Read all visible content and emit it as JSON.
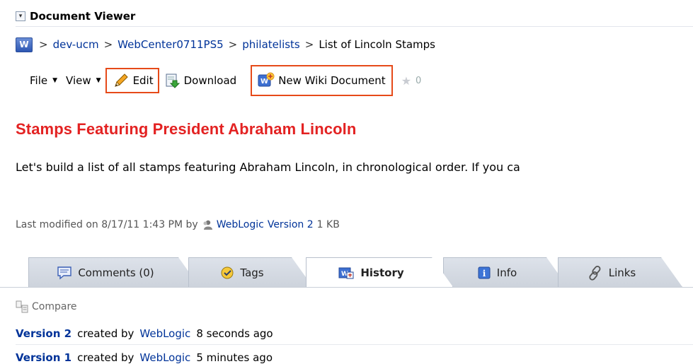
{
  "panel": {
    "title": "Document Viewer"
  },
  "breadcrumb": {
    "logo_letter": "W",
    "items": [
      "dev-ucm",
      "WebCenter0711PS5",
      "philatelists",
      "List of Lincoln Stamps"
    ]
  },
  "toolbar": {
    "file_label": "File",
    "view_label": "View",
    "edit_label": "Edit",
    "download_label": "Download",
    "new_wiki_label": "New Wiki Document",
    "star_count": "0"
  },
  "document": {
    "title": "Stamps Featuring President Abraham Lincoln",
    "body": "Let's build a list of all stamps featuring Abraham Lincoln, in chronological order.  If you ca"
  },
  "meta": {
    "prefix": "Last modified on 8/17/11 1:43 PM by",
    "author": "WebLogic",
    "version": "Version 2",
    "size": "1 KB"
  },
  "tabs": [
    {
      "label": "Comments (0)",
      "icon": "comment-icon"
    },
    {
      "label": "Tags",
      "icon": "tag-icon"
    },
    {
      "label": "History",
      "icon": "history-icon"
    },
    {
      "label": "Info",
      "icon": "info-icon"
    },
    {
      "label": "Links",
      "icon": "link-icon"
    }
  ],
  "history": {
    "compare_label": "Compare",
    "rows": [
      {
        "version": "Version 2",
        "created_by": "created by",
        "user": "WebLogic",
        "when": "8 seconds ago"
      },
      {
        "version": "Version 1",
        "created_by": "created by",
        "user": "WebLogic",
        "when": "5 minutes ago"
      }
    ]
  },
  "colors": {
    "title": "#e32222",
    "link": "#003399",
    "highlight": "#e64a19"
  }
}
